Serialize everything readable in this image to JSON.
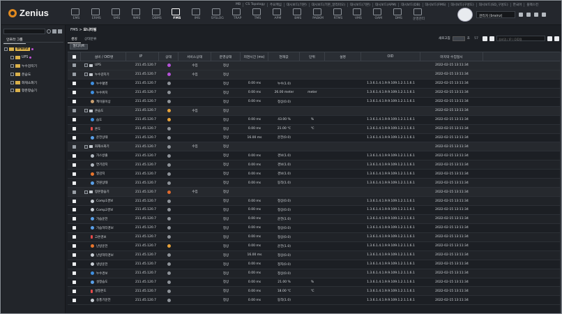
{
  "app": {
    "brand": "Zenius",
    "top_links": [
      "MB",
      "CS Topology",
      "주요핵심",
      "대시보드(기본)",
      "대시보드(기본_알리미오)",
      "대시보드(기본)",
      "대시보드(APM)",
      "대시보드(DB)",
      "대시보드(FMS)",
      "대시보드(구성도)",
      "대시보드(SD_구성도)",
      "한국어",
      "블랙스킨"
    ],
    "modules": [
      "EMS",
      "ERMS",
      "SMS",
      "NMS",
      "DBMS",
      "FMS",
      "IMS",
      "SYSLOG",
      "TRAP",
      "TMS",
      "APM",
      "BMS",
      "PABKM",
      "RTMS",
      "VMS",
      "OAM",
      "DMS",
      "운영관리"
    ],
    "active_module": "FMS",
    "user_label": "관리자 (brainz)"
  },
  "left": {
    "search_placeholder": "",
    "tab": "인프라 그룹",
    "tree": [
      {
        "label": "brainz",
        "level": 0,
        "highlight": true
      },
      {
        "label": "UPS",
        "level": 1
      },
      {
        "label": "누수감지기",
        "level": 1
      },
      {
        "label": "온습도",
        "level": 1
      },
      {
        "label": "화재소화기",
        "level": 1
      },
      {
        "label": "항온항습기",
        "level": 1
      }
    ]
  },
  "main": {
    "breadcrumb_root": "FMS",
    "breadcrumb_sep": ">",
    "breadcrumb_page": "모니터링",
    "tabs": [
      "센싱",
      "상태분류"
    ],
    "active_tab": "센싱",
    "refresh_label": "새로고침",
    "interval_unit": "초",
    "count": "57",
    "search_placeholder": "설비명 / IP / OID명",
    "sub_button": "멀티차트",
    "columns": [
      "",
      "설비 / OID명",
      "IP",
      "상태",
      "서비스상태",
      "운영상태",
      "지연시간 (ms)",
      "현재값",
      "단위",
      "설명",
      "OID",
      "마지막 수집일시"
    ],
    "rows": [
      {
        "type": "grp",
        "name": "UPS",
        "icon": "group",
        "ip": "211.45.120.7",
        "dot": "purple",
        "svc": "수집",
        "op": "정상",
        "delay": "",
        "value": "",
        "unit": "",
        "desc": "",
        "oid": "",
        "time": "2022-02-15 13:11:34"
      },
      {
        "type": "grp",
        "name": "누수감지기",
        "icon": "group",
        "ip": "211.45.120.7",
        "dot": "purple",
        "svc": "수집",
        "op": "정상",
        "delay": "",
        "value": "",
        "unit": "",
        "desc": "",
        "oid": "",
        "time": "2022-02-15 13:11:34"
      },
      {
        "type": "item",
        "name": "누수혈영",
        "icon": "drop",
        "ip": "211.45.120.7",
        "dot": "gray",
        "svc": "",
        "op": "정상",
        "delay": "0.00 ms",
        "value": "누수(1.0)",
        "unit": "",
        "desc": "",
        "oid": "1.3.6.1.4.1.9.9.109.1.2.1.1.6.1",
        "time": "2022-02-15 13:11:34"
      },
      {
        "type": "item",
        "name": "누수위치",
        "icon": "drop",
        "ip": "211.45.120.7",
        "dot": "gray",
        "svc": "",
        "op": "정상",
        "delay": "0.00 ms",
        "value": "26.00 meter",
        "unit": "meter",
        "desc": "",
        "oid": "1.3.6.1.4.1.9.9.109.1.2.1.1.6.1",
        "time": "2022-02-15 13:11:34"
      },
      {
        "type": "item",
        "name": "케이블이상",
        "icon": "pers",
        "ip": "211.45.120.7",
        "dot": "gray",
        "svc": "",
        "op": "정상",
        "delay": "0.00 ms",
        "value": "정상(0.0)",
        "unit": "",
        "desc": "",
        "oid": "1.3.6.1.4.1.9.9.109.1.2.1.1.6.1",
        "time": "2022-02-15 13:11:34"
      },
      {
        "type": "grp",
        "name": "온습도",
        "icon": "group",
        "ip": "211.45.120.7",
        "dot": "orange",
        "svc": "수집",
        "op": "정상",
        "delay": "",
        "value": "",
        "unit": "",
        "desc": "",
        "oid": "",
        "time": "2022-02-15 13:11:34"
      },
      {
        "type": "item",
        "name": "습도",
        "icon": "drop",
        "ip": "211.45.120.7",
        "dot": "orange",
        "svc": "",
        "op": "정상",
        "delay": "0.00 ms",
        "value": "43.00 %",
        "unit": "%",
        "desc": "",
        "oid": "1.3.6.1.4.1.9.9.109.1.2.1.1.6.1",
        "time": "2022-02-15 13:11:34"
      },
      {
        "type": "item",
        "name": "온도",
        "icon": "therm",
        "ip": "211.45.120.7",
        "dot": "gray",
        "svc": "",
        "op": "정상",
        "delay": "0.00 ms",
        "value": "21.00 ℃",
        "unit": "℃",
        "desc": "",
        "oid": "1.3.6.1.4.1.9.9.109.1.2.1.1.6.1",
        "time": "2022-02-15 13:11:34"
      },
      {
        "type": "item",
        "name": "운전상태",
        "icon": "spark",
        "ip": "211.45.120.7",
        "dot": "gray",
        "svc": "",
        "op": "정상",
        "delay": "16.00 ms",
        "value": "운전(0.0)",
        "unit": "",
        "desc": "",
        "oid": "1.3.6.1.4.1.9.9.109.1.2.1.1.6.1",
        "time": "2022-02-15 13:11:34"
      },
      {
        "type": "grp",
        "name": "화재소화기",
        "icon": "group",
        "ip": "211.45.120.7",
        "dot": "gray",
        "svc": "수집",
        "op": "정상",
        "delay": "",
        "value": "",
        "unit": "",
        "desc": "",
        "oid": "",
        "time": "2022-02-15 13:11:34"
      },
      {
        "type": "item",
        "name": "가스방출",
        "icon": "gas",
        "ip": "211.45.120.7",
        "dot": "gray",
        "svc": "",
        "op": "정상",
        "delay": "0.00 ms",
        "value": "경보(1.0)",
        "unit": "",
        "desc": "",
        "oid": "1.3.6.1.4.1.9.9.109.1.2.1.1.6.1",
        "time": "2022-02-15 13:11:34"
      },
      {
        "type": "item",
        "name": "연기감지",
        "icon": "gas",
        "ip": "211.45.120.7",
        "dot": "gray",
        "svc": "",
        "op": "정상",
        "delay": "0.00 ms",
        "value": "경보(1.0)",
        "unit": "",
        "desc": "",
        "oid": "1.3.6.1.4.1.9.9.109.1.2.1.1.6.1",
        "time": "2022-02-15 13:11:34"
      },
      {
        "type": "item",
        "name": "열감지",
        "icon": "fire",
        "ip": "211.45.120.7",
        "dot": "gray",
        "svc": "",
        "op": "정상",
        "delay": "0.00 ms",
        "value": "경보(1.0)",
        "unit": "",
        "desc": "",
        "oid": "1.3.6.1.4.1.9.9.109.1.2.1.1.6.1",
        "time": "2022-02-15 13:11:34"
      },
      {
        "type": "item",
        "name": "전원상태",
        "icon": "spark",
        "ip": "211.45.120.7",
        "dot": "gray",
        "svc": "",
        "op": "정상",
        "delay": "0.00 ms",
        "value": "동작(1.0)",
        "unit": "",
        "desc": "",
        "oid": "1.3.6.1.4.1.9.9.109.1.2.1.1.6.1",
        "time": "2022-02-15 13:11:34"
      },
      {
        "type": "grp",
        "name": "항온항습기",
        "icon": "group",
        "ip": "211.45.120.7",
        "dot": "deep",
        "svc": "수집",
        "op": "정상",
        "delay": "",
        "value": "",
        "unit": "",
        "desc": "",
        "oid": "",
        "time": "2022-02-15 13:11:34"
      },
      {
        "type": "item",
        "name": "Comp1경보",
        "icon": "fan",
        "ip": "211.45.120.7",
        "dot": "gray",
        "svc": "",
        "op": "정상",
        "delay": "0.00 ms",
        "value": "정상(0.0)",
        "unit": "",
        "desc": "",
        "oid": "1.3.6.1.4.1.9.9.109.1.2.1.1.6.1",
        "time": "2022-02-15 13:11:34"
      },
      {
        "type": "item",
        "name": "Comp2경보",
        "icon": "fan",
        "ip": "211.45.120.7",
        "dot": "gray",
        "svc": "",
        "op": "정상",
        "delay": "0.00 ms",
        "value": "정상(0.0)",
        "unit": "",
        "desc": "",
        "oid": "1.3.6.1.4.1.9.9.109.1.2.1.1.6.1",
        "time": "2022-02-15 13:11:34"
      },
      {
        "type": "item",
        "name": "가습운전",
        "icon": "spark",
        "ip": "211.45.120.7",
        "dot": "gray",
        "svc": "",
        "op": "정상",
        "delay": "0.00 ms",
        "value": "운전(1.0)",
        "unit": "",
        "desc": "",
        "oid": "1.3.6.1.4.1.9.9.109.1.2.1.1.6.1",
        "time": "2022-02-15 13:11:34"
      },
      {
        "type": "item",
        "name": "가습히터경보",
        "icon": "spark",
        "ip": "211.45.120.7",
        "dot": "gray",
        "svc": "",
        "op": "정상",
        "delay": "0.00 ms",
        "value": "정상(0.0)",
        "unit": "",
        "desc": "",
        "oid": "1.3.6.1.4.1.9.9.109.1.2.1.1.6.1",
        "time": "2022-02-15 13:11:34"
      },
      {
        "type": "item",
        "name": "고온경보",
        "icon": "therm",
        "ip": "211.45.120.7",
        "dot": "gray",
        "svc": "",
        "op": "정상",
        "delay": "0.00 ms",
        "value": "정상(0.0)",
        "unit": "",
        "desc": "",
        "oid": "1.3.6.1.4.1.9.9.109.1.2.1.1.6.1",
        "time": "2022-02-15 13:11:34"
      },
      {
        "type": "item",
        "name": "난방운전",
        "icon": "fire",
        "ip": "211.45.120.7",
        "dot": "orange",
        "svc": "",
        "op": "정상",
        "delay": "0.00 ms",
        "value": "운전(1.0)",
        "unit": "",
        "desc": "",
        "oid": "1.3.6.1.4.1.9.9.109.1.2.1.1.6.1",
        "time": "2022-02-15 13:11:34"
      },
      {
        "type": "item",
        "name": "난방히터경보",
        "icon": "fan",
        "ip": "211.45.120.7",
        "dot": "gray",
        "svc": "",
        "op": "정상",
        "delay": "16.00 ms",
        "value": "정상(0.0)",
        "unit": "",
        "desc": "",
        "oid": "1.3.6.1.4.1.9.9.109.1.2.1.1.6.1",
        "time": "2022-02-15 13:11:34"
      },
      {
        "type": "item",
        "name": "냉방운전",
        "icon": "fan",
        "ip": "211.45.120.7",
        "dot": "gray",
        "svc": "",
        "op": "정상",
        "delay": "0.00 ms",
        "value": "정지(0.0)",
        "unit": "",
        "desc": "",
        "oid": "1.3.6.1.4.1.9.9.109.1.2.1.1.6.1",
        "time": "2022-02-15 13:11:34"
      },
      {
        "type": "item",
        "name": "누수경보",
        "icon": "drop",
        "ip": "211.45.120.7",
        "dot": "gray",
        "svc": "",
        "op": "정상",
        "delay": "0.00 ms",
        "value": "정상(0.0)",
        "unit": "",
        "desc": "",
        "oid": "1.3.6.1.4.1.9.9.109.1.2.1.1.6.1",
        "time": "2022-02-15 13:11:34"
      },
      {
        "type": "item",
        "name": "설정습도",
        "icon": "spark",
        "ip": "211.45.120.7",
        "dot": "gray",
        "svc": "",
        "op": "정상",
        "delay": "0.00 ms",
        "value": "21.00 %",
        "unit": "%",
        "desc": "",
        "oid": "1.3.6.1.4.1.9.9.109.1.2.1.1.6.1",
        "time": "2022-02-15 13:11:34"
      },
      {
        "type": "item",
        "name": "설정온도",
        "icon": "therm",
        "ip": "211.45.120.7",
        "dot": "gray",
        "svc": "",
        "op": "정상",
        "delay": "0.00 ms",
        "value": "18.00 ℃",
        "unit": "℃",
        "desc": "",
        "oid": "1.3.6.1.4.1.9.9.109.1.2.1.1.6.1",
        "time": "2022-02-15 13:11:34"
      },
      {
        "type": "item",
        "name": "송풍기운전",
        "icon": "fan",
        "ip": "211.45.120.7",
        "dot": "gray",
        "svc": "",
        "op": "정상",
        "delay": "0.00 ms",
        "value": "동작(1.0)",
        "unit": "",
        "desc": "",
        "oid": "1.3.6.1.4.1.9.9.109.1.2.1.1.6.1",
        "time": "2022-02-15 13:11:34"
      }
    ]
  }
}
